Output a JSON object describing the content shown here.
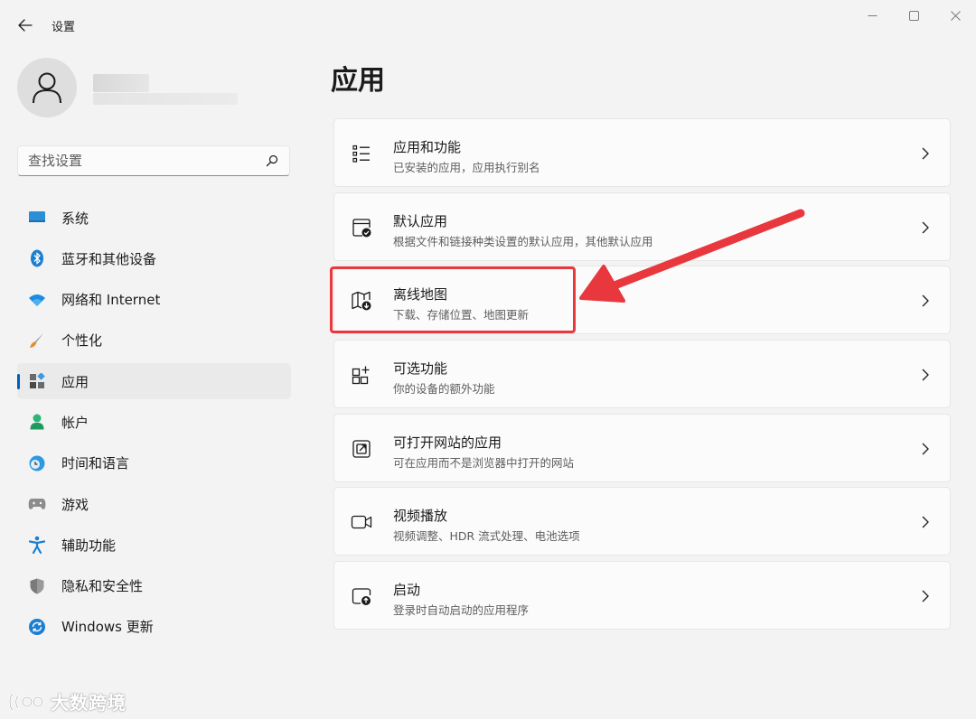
{
  "window": {
    "title": "设置",
    "controls": [
      "minimize",
      "maximize",
      "close"
    ]
  },
  "sidebar": {
    "search": {
      "placeholder": "查找设置",
      "value": ""
    },
    "items": [
      {
        "label": "系统",
        "icon": "system-display-icon"
      },
      {
        "label": "蓝牙和其他设备",
        "icon": "bluetooth-icon"
      },
      {
        "label": "网络和 Internet",
        "icon": "wifi-icon"
      },
      {
        "label": "个性化",
        "icon": "paint-brush-icon"
      },
      {
        "label": "应用",
        "icon": "apps-icon",
        "active": true
      },
      {
        "label": "帐户",
        "icon": "account-icon"
      },
      {
        "label": "时间和语言",
        "icon": "time-language-icon"
      },
      {
        "label": "游戏",
        "icon": "gamepad-icon"
      },
      {
        "label": "辅助功能",
        "icon": "accessibility-icon"
      },
      {
        "label": "隐私和安全性",
        "icon": "shield-icon"
      },
      {
        "label": "Windows 更新",
        "icon": "windows-update-icon"
      }
    ]
  },
  "main": {
    "title": "应用",
    "cards": [
      {
        "title": "应用和功能",
        "subtitle": "已安装的应用，应用执行别名",
        "icon": "list-icon"
      },
      {
        "title": "默认应用",
        "subtitle": "根据文件和链接种类设置的默认应用，其他默认应用",
        "icon": "default-apps-icon"
      },
      {
        "title": "离线地图",
        "subtitle": "下载、存储位置、地图更新",
        "icon": "offline-map-icon"
      },
      {
        "title": "可选功能",
        "subtitle": "你的设备的额外功能",
        "icon": "optional-features-icon"
      },
      {
        "title": "可打开网站的应用",
        "subtitle": "可在应用而不是浏览器中打开的网站",
        "icon": "open-website-icon"
      },
      {
        "title": "视频播放",
        "subtitle": "视频调整、HDR 流式处理、电池选项",
        "icon": "video-camera-icon"
      },
      {
        "title": "启动",
        "subtitle": "登录时自动启动的应用程序",
        "icon": "startup-icon"
      }
    ]
  },
  "annotation": {
    "highlighted_card": "离线地图",
    "color": "#e8383d"
  },
  "watermark": {
    "text": "大数跨境"
  },
  "colors": {
    "accent": "#005fb8",
    "background": "#f3f3f3",
    "card": "#fbfbfb"
  }
}
